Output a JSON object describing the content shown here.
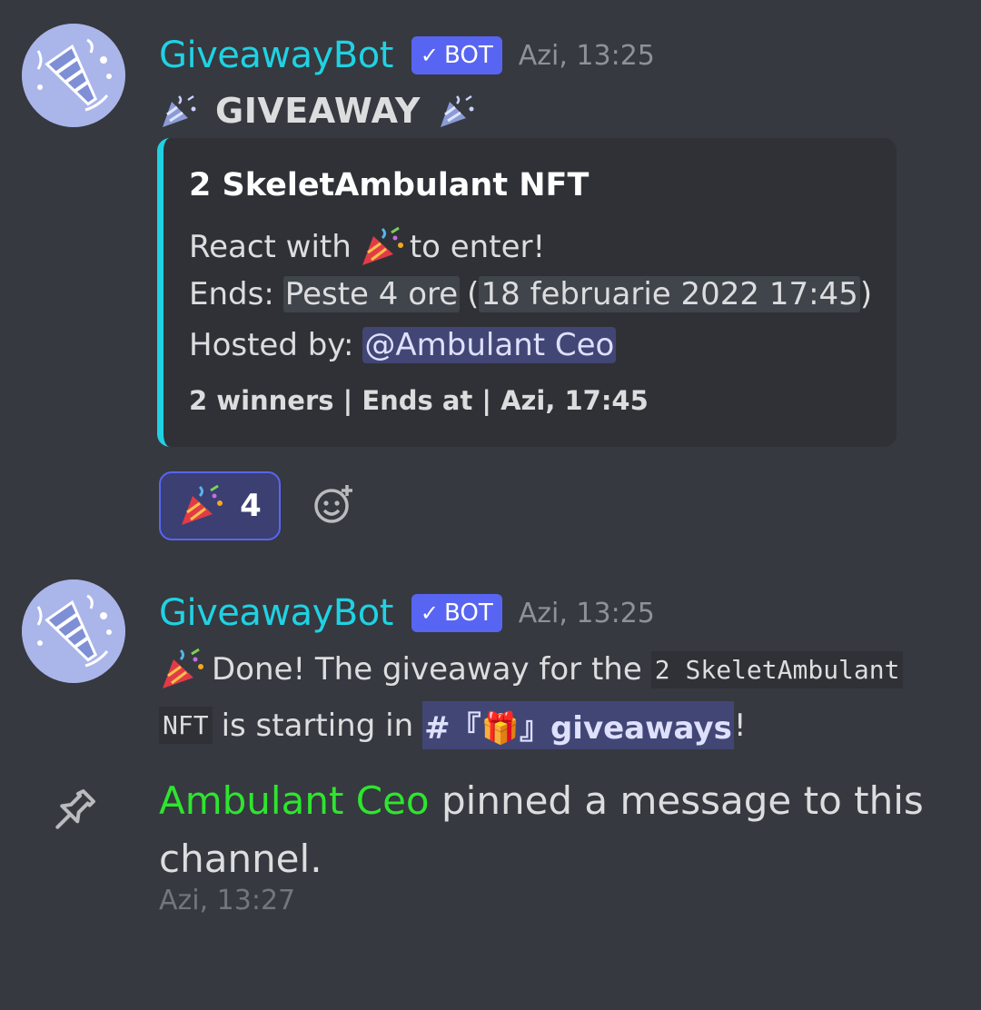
{
  "messages": [
    {
      "username": "GiveawayBot",
      "bot_tag": "BOT",
      "check": "✓",
      "timestamp": "Azi, 13:25",
      "giveaway_title": "GIVEAWAY",
      "embed": {
        "title": "2 SkeletAmbulant NFT",
        "react_prefix": "React with",
        "react_suffix": "to enter!",
        "ends_label": "Ends:",
        "ends_relative": "Peste 4 ore",
        "ends_paren_open": "(",
        "ends_absolute": "18 februarie 2022 17:45",
        "ends_paren_close": ")",
        "hosted_label": "Hosted by:",
        "hosted_mention": "@Ambulant Ceo",
        "footer": "2 winners | Ends at | Azi, 17:45",
        "accent_color": "#1fd2e3"
      },
      "reaction": {
        "emoji": "tada-icon",
        "count": "4"
      }
    },
    {
      "username": "GiveawayBot",
      "bot_tag": "BOT",
      "check": "✓",
      "timestamp": "Azi, 13:25",
      "text_part1": "Done! The giveaway for the",
      "code_part1": "2 SkeletAmbulant",
      "code_part2": "NFT",
      "text_part2": "is starting in",
      "channel": "#『🎁』giveaways",
      "text_part3": "!"
    }
  ],
  "system": {
    "user": "Ambulant Ceo",
    "action_line1": "pinned a message to this",
    "action_line2": "channel.",
    "timestamp": "Azi, 13:27",
    "user_color": "#2ee52e"
  },
  "colors": {
    "background": "#36393f",
    "username": "#1fd2e3",
    "bot_tag": "#5865f2",
    "mention_bg": "#414675"
  }
}
